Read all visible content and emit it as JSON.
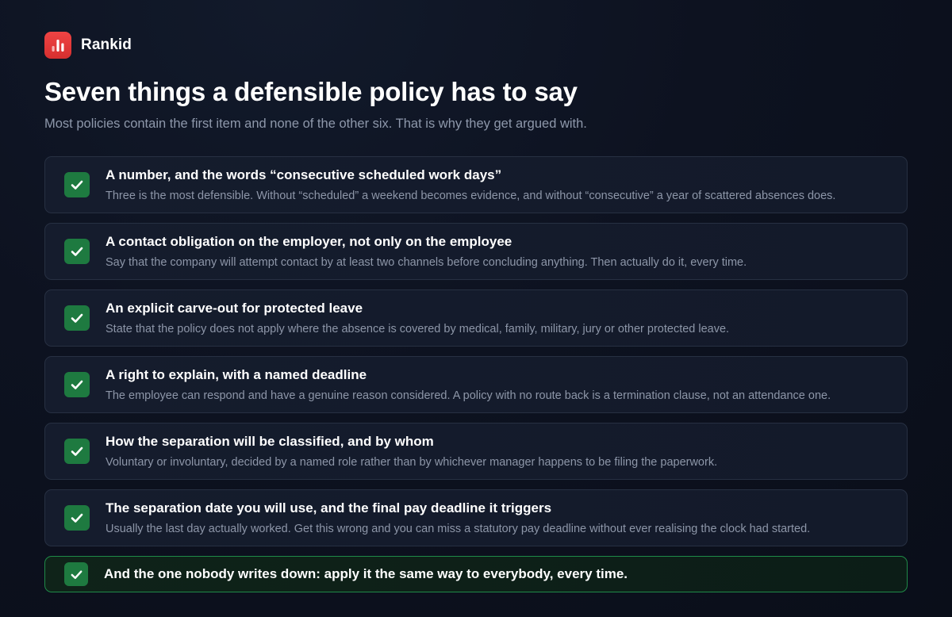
{
  "brand": {
    "name": "Rankid",
    "logo_icon": "bar-chart-icon",
    "logo_color": "#e53935"
  },
  "header": {
    "title": "Seven things a defensible policy has to say",
    "subtitle": "Most policies contain the first item and none of the other six. That is why they get argued with."
  },
  "checklist": {
    "check_icon": "checkmark-icon",
    "check_color": "#1e7a40",
    "items": [
      {
        "title": "A number, and the words “consecutive scheduled work days”",
        "description": "Three is the most defensible. Without “scheduled” a weekend becomes evidence, and without “consecutive” a year of scattered absences does."
      },
      {
        "title": "A contact obligation on the employer, not only on the employee",
        "description": "Say that the company will attempt contact by at least two channels before concluding anything. Then actually do it, every time."
      },
      {
        "title": "An explicit carve-out for protected leave",
        "description": "State that the policy does not apply where the absence is covered by medical, family, military, jury or other protected leave."
      },
      {
        "title": "A right to explain, with a named deadline",
        "description": "The employee can respond and have a genuine reason considered. A policy with no route back is a termination clause, not an attendance one."
      },
      {
        "title": "How the separation will be classified, and by whom",
        "description": "Voluntary or involuntary, decided by a named role rather than by whichever manager happens to be filing the paperwork."
      },
      {
        "title": "The separation date you will use, and the final pay deadline it triggers",
        "description": "Usually the last day actually worked. Get this wrong and you can miss a statutory pay deadline without ever realising the clock had started."
      }
    ],
    "final_item": {
      "title": "And the one nobody writes down: apply it the same way to everybody, every time."
    }
  }
}
